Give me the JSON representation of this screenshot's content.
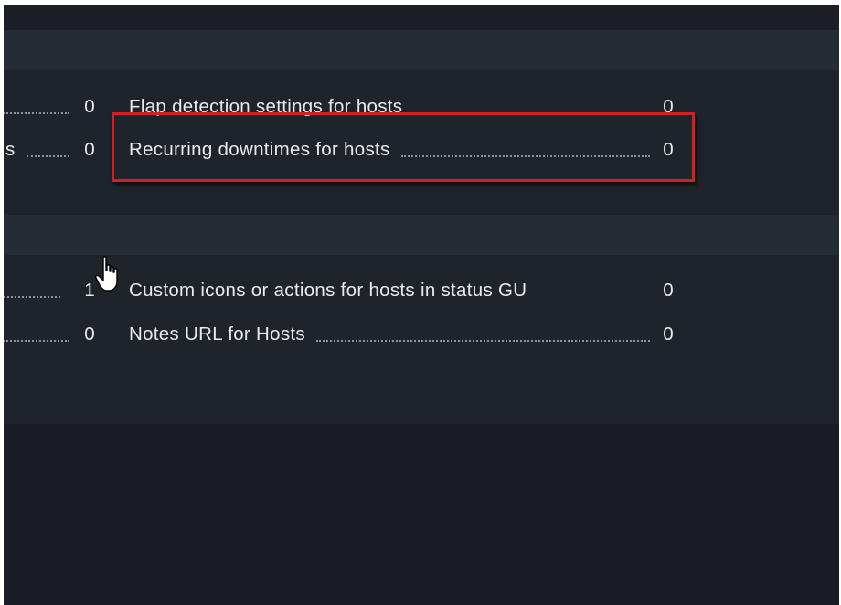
{
  "section1": {
    "left_rows": [
      {
        "label": "",
        "count": "0"
      },
      {
        "label": "s",
        "count": "0"
      }
    ],
    "right_rows": [
      {
        "label": "Flap detection settings for hosts",
        "count": "0"
      },
      {
        "label": "Recurring downtimes for hosts",
        "count": "0"
      }
    ]
  },
  "section2": {
    "left_rows": [
      {
        "label": "",
        "count": "1"
      },
      {
        "label": "",
        "count": "0"
      }
    ],
    "right_rows": [
      {
        "label": "Custom icons or actions for hosts in status GU",
        "count": "0"
      },
      {
        "label": "Notes URL for Hosts",
        "count": "0"
      }
    ]
  },
  "colors": {
    "highlight": "#d61f1f",
    "background": "#1f242b"
  },
  "icons": {
    "cursor": "hand-pointer-icon"
  }
}
